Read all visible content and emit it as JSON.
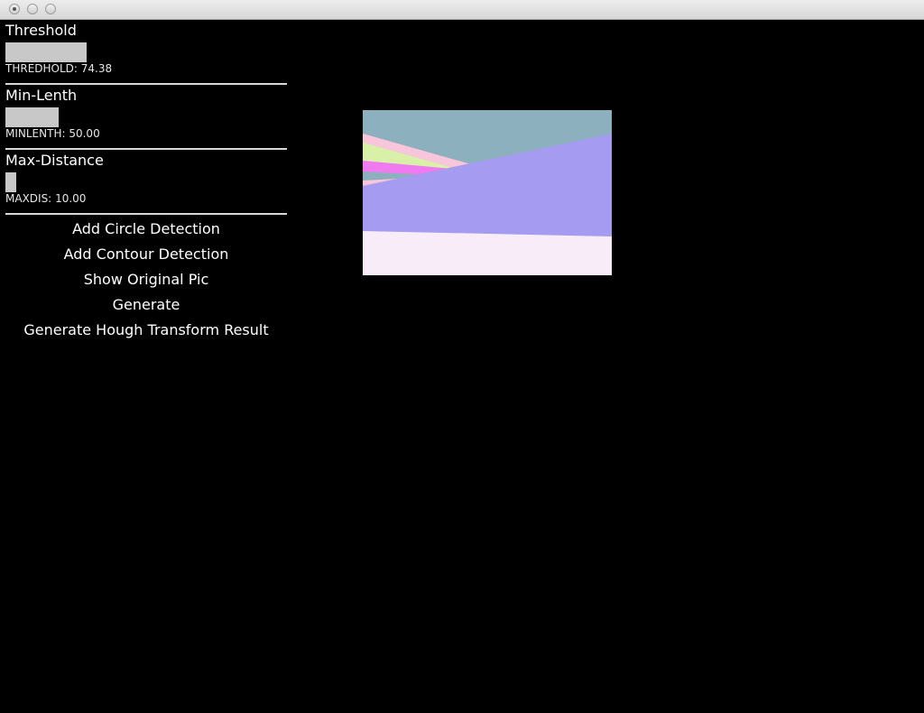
{
  "window": {
    "controls": [
      "close",
      "minimize",
      "zoom"
    ]
  },
  "controls": [
    {
      "title": "Threshold",
      "readout_label": "THREDHOLD:",
      "readout_value": "74.38",
      "fill_fraction": 0.29
    },
    {
      "title": "Min-Lenth",
      "readout_label": "MINLENTH:",
      "readout_value": "50.00",
      "fill_fraction": 0.19
    },
    {
      "title": "Max-Distance",
      "readout_label": "MAXDIS:",
      "readout_value": "10.00",
      "fill_fraction": 0.04
    }
  ],
  "actions": [
    "Add Circle Detection",
    "Add Contour Detection",
    "Show Original Pic",
    "Generate",
    "Generate Hough Transform Result"
  ],
  "colors": {
    "background": "#000000",
    "slider_fill": "#c8c8c8",
    "divider": "#d9d9d9",
    "preview_sky": "#8db0bf",
    "preview_band_purple": "#a59bf0",
    "preview_band_pink": "#f7c6da",
    "preview_band_lime": "#d8f0a8",
    "preview_band_magenta": "#f07af0",
    "preview_floor": "#f8ecf8"
  }
}
